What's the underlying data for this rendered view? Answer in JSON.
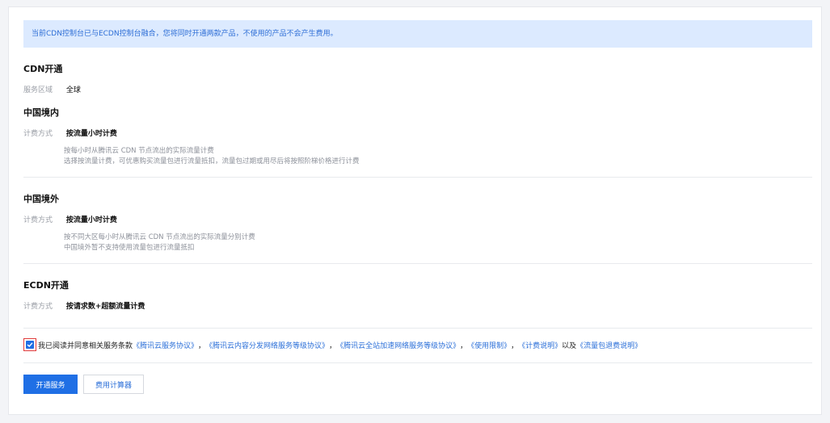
{
  "notice": "当前CDN控制台已与ECDN控制台融合，您将同时开通两款产品，不使用的产品不会产生费用。",
  "cdn": {
    "title": "CDN开通",
    "region_label": "服务区域",
    "region_value": "全球"
  },
  "mainland": {
    "title": "中国境内",
    "billing_label": "计费方式",
    "billing_value": "按流量小时计费",
    "desc_1": "按每小时从腾讯云 CDN 节点流出的实际流量计费",
    "desc_2": "选择按流量计费，可优惠购买流量包进行流量抵扣，流量包过期或用尽后将按照阶梯价格进行计费"
  },
  "overseas": {
    "title": "中国境外",
    "billing_label": "计费方式",
    "billing_value": "按流量小时计费",
    "desc_1": "按不同大区每小时从腾讯云 CDN 节点流出的实际流量分别计费",
    "desc_2": "中国境外暂不支持使用流量包进行流量抵扣"
  },
  "ecdn": {
    "title": "ECDN开通",
    "billing_label": "计费方式",
    "billing_value": "按请求数+超额流量计费"
  },
  "agreement": {
    "prefix": "我已阅读并同意相关服务条款",
    "link_1": "《腾讯云服务协议》",
    "sep_1": "，",
    "link_2": "《腾讯云内容分发网络服务等级协议》",
    "sep_2": "，",
    "link_3": "《腾讯云全站加速网络服务等级协议》",
    "sep_3": "，",
    "link_4": "《使用限制》",
    "sep_4": "，",
    "link_5": "《计费说明》",
    "sep_5": "以及",
    "link_6": "《流量包退费说明》"
  },
  "buttons": {
    "open": "开通服务",
    "calculator": "费用计算器"
  },
  "colors": {
    "accent": "#1f6fe5",
    "notice_bg": "#dceaff",
    "highlight": "#e23b3b"
  }
}
